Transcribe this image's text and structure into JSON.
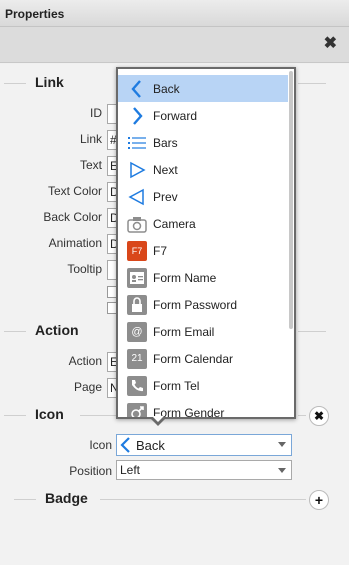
{
  "window": {
    "title": "Properties"
  },
  "sections": {
    "link": "Link",
    "action": "Action",
    "icon": "Icon",
    "badge": "Badge"
  },
  "link_fields": [
    {
      "label": "ID",
      "value": ""
    },
    {
      "label": "Link",
      "value": "#"
    },
    {
      "label": "Text",
      "value": "E"
    },
    {
      "label": "Text Color",
      "value": "D"
    },
    {
      "label": "Back Color",
      "value": "D"
    },
    {
      "label": "Animation",
      "value": "D"
    },
    {
      "label": "Tooltip",
      "value": ""
    }
  ],
  "action_fields": [
    {
      "label": "Action",
      "value": "E"
    },
    {
      "label": "Page",
      "value": "N"
    }
  ],
  "icon_fields": {
    "icon_label": "Icon",
    "icon_value": "Back",
    "position_label": "Position",
    "position_value": "Left"
  },
  "dropdown_items": [
    {
      "label": "Back",
      "icon": "chevron-left-icon",
      "selected": true
    },
    {
      "label": "Forward",
      "icon": "chevron-right-icon"
    },
    {
      "label": "Bars",
      "icon": "bars-icon"
    },
    {
      "label": "Next",
      "icon": "triangle-right-icon"
    },
    {
      "label": "Prev",
      "icon": "triangle-left-icon"
    },
    {
      "label": "Camera",
      "icon": "camera-icon"
    },
    {
      "label": "F7",
      "icon": "f7-icon",
      "badge_text": "F7"
    },
    {
      "label": "Form Name",
      "icon": "name-card-icon"
    },
    {
      "label": "Form Password",
      "icon": "lock-icon"
    },
    {
      "label": "Form Email",
      "icon": "at-icon",
      "glyph": "@"
    },
    {
      "label": "Form Calendar",
      "icon": "calendar-icon",
      "glyph": "21"
    },
    {
      "label": "Form Tel",
      "icon": "phone-icon"
    },
    {
      "label": "Form Gender",
      "icon": "gender-icon"
    }
  ],
  "colors": {
    "accent": "#1e7be0",
    "selected_bg": "#b8d4f5",
    "f7_red": "#d9471a"
  }
}
